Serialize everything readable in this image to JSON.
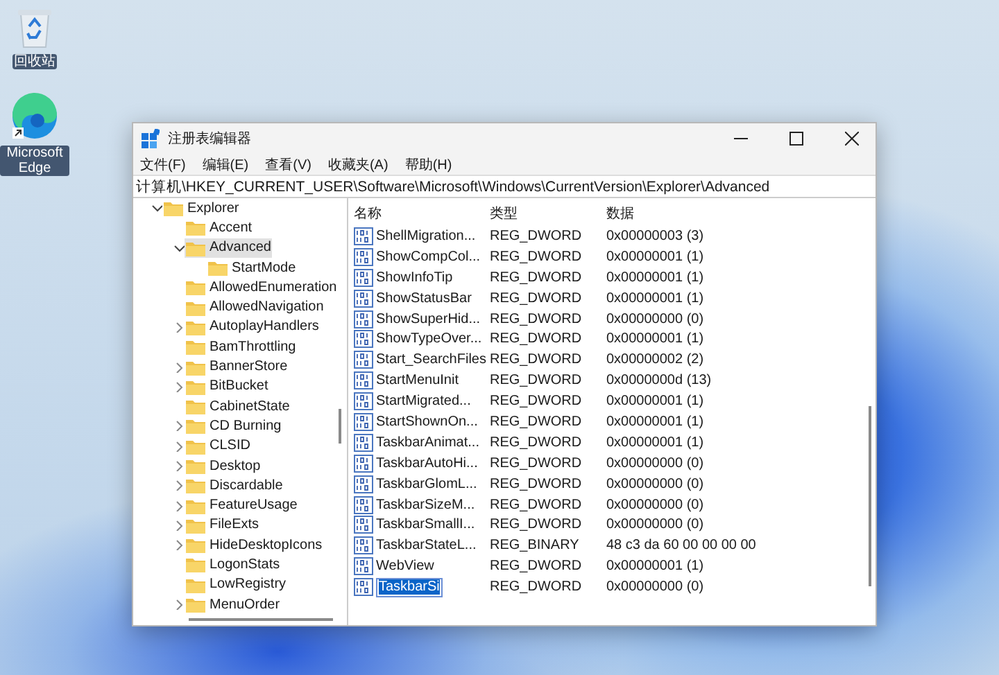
{
  "desktop_icons": [
    {
      "kind": "bin",
      "label": "回收站"
    },
    {
      "kind": "browser",
      "label": "Microsoft Edge"
    }
  ],
  "window": {
    "title": "注册表编辑器",
    "menu": [
      "文件(F)",
      "编辑(E)",
      "查看(V)",
      "收藏夹(A)",
      "帮助(H)"
    ],
    "address": "计算机\\HKEY_CURRENT_USER\\Software\\Microsoft\\Windows\\CurrentVersion\\Explorer\\Advanced",
    "tree": [
      {
        "label": "Explorer",
        "has_children": true,
        "expanded": true,
        "selected": false,
        "children": [
          {
            "label": "Accent",
            "has_children": false,
            "selected": false
          },
          {
            "label": "Advanced",
            "has_children": true,
            "expanded": true,
            "selected": true,
            "children": [
              {
                "label": "StartMode",
                "has_children": false,
                "selected": false
              }
            ]
          },
          {
            "label": "AllowedEnumeration",
            "has_children": false,
            "selected": false
          },
          {
            "label": "AllowedNavigation",
            "has_children": false,
            "selected": false
          },
          {
            "label": "AutoplayHandlers",
            "has_children": true,
            "expanded": false,
            "selected": false
          },
          {
            "label": "BamThrottling",
            "has_children": false,
            "selected": false
          },
          {
            "label": "BannerStore",
            "has_children": true,
            "expanded": false,
            "selected": false
          },
          {
            "label": "BitBucket",
            "has_children": true,
            "expanded": false,
            "selected": false
          },
          {
            "label": "CabinetState",
            "has_children": false,
            "selected": false
          },
          {
            "label": "CD Burning",
            "has_children": true,
            "expanded": false,
            "selected": false
          },
          {
            "label": "CLSID",
            "has_children": true,
            "expanded": false,
            "selected": false
          },
          {
            "label": "Desktop",
            "has_children": true,
            "expanded": false,
            "selected": false
          },
          {
            "label": "Discardable",
            "has_children": true,
            "expanded": false,
            "selected": false
          },
          {
            "label": "FeatureUsage",
            "has_children": true,
            "expanded": false,
            "selected": false
          },
          {
            "label": "FileExts",
            "has_children": true,
            "expanded": false,
            "selected": false
          },
          {
            "label": "HideDesktopIcons",
            "has_children": true,
            "expanded": false,
            "selected": false
          },
          {
            "label": "LogonStats",
            "has_children": false,
            "selected": false
          },
          {
            "label": "LowRegistry",
            "has_children": false,
            "selected": false
          },
          {
            "label": "MenuOrder",
            "has_children": true,
            "expanded": false,
            "selected": false
          }
        ]
      }
    ],
    "columns": [
      "名称",
      "类型",
      "数据"
    ],
    "values": [
      {
        "name": "ShellMigration...",
        "type": "REG_DWORD",
        "data": "0x00000003 (3)",
        "editing": false
      },
      {
        "name": "ShowCompCol...",
        "type": "REG_DWORD",
        "data": "0x00000001 (1)",
        "editing": false
      },
      {
        "name": "ShowInfoTip",
        "type": "REG_DWORD",
        "data": "0x00000001 (1)",
        "editing": false
      },
      {
        "name": "ShowStatusBar",
        "type": "REG_DWORD",
        "data": "0x00000001 (1)",
        "editing": false
      },
      {
        "name": "ShowSuperHid...",
        "type": "REG_DWORD",
        "data": "0x00000000 (0)",
        "editing": false
      },
      {
        "name": "ShowTypeOver...",
        "type": "REG_DWORD",
        "data": "0x00000001 (1)",
        "editing": false
      },
      {
        "name": "Start_SearchFiles",
        "type": "REG_DWORD",
        "data": "0x00000002 (2)",
        "editing": false
      },
      {
        "name": "StartMenuInit",
        "type": "REG_DWORD",
        "data": "0x0000000d (13)",
        "editing": false
      },
      {
        "name": "StartMigrated...",
        "type": "REG_DWORD",
        "data": "0x00000001 (1)",
        "editing": false
      },
      {
        "name": "StartShownOn...",
        "type": "REG_DWORD",
        "data": "0x00000001 (1)",
        "editing": false
      },
      {
        "name": "TaskbarAnimat...",
        "type": "REG_DWORD",
        "data": "0x00000001 (1)",
        "editing": false
      },
      {
        "name": "TaskbarAutoHi...",
        "type": "REG_DWORD",
        "data": "0x00000000 (0)",
        "editing": false
      },
      {
        "name": "TaskbarGlomL...",
        "type": "REG_DWORD",
        "data": "0x00000000 (0)",
        "editing": false
      },
      {
        "name": "TaskbarSizeM...",
        "type": "REG_DWORD",
        "data": "0x00000000 (0)",
        "editing": false
      },
      {
        "name": "TaskbarSmallI...",
        "type": "REG_DWORD",
        "data": "0x00000000 (0)",
        "editing": false
      },
      {
        "name": "TaskbarStateL...",
        "type": "REG_BINARY",
        "data": "48 c3 da 60 00 00 00 00",
        "editing": false
      },
      {
        "name": "WebView",
        "type": "REG_DWORD",
        "data": "0x00000001 (1)",
        "editing": false
      },
      {
        "name": "TaskbarSi",
        "type": "REG_DWORD",
        "data": "0x00000000 (0)",
        "editing": true
      }
    ]
  }
}
